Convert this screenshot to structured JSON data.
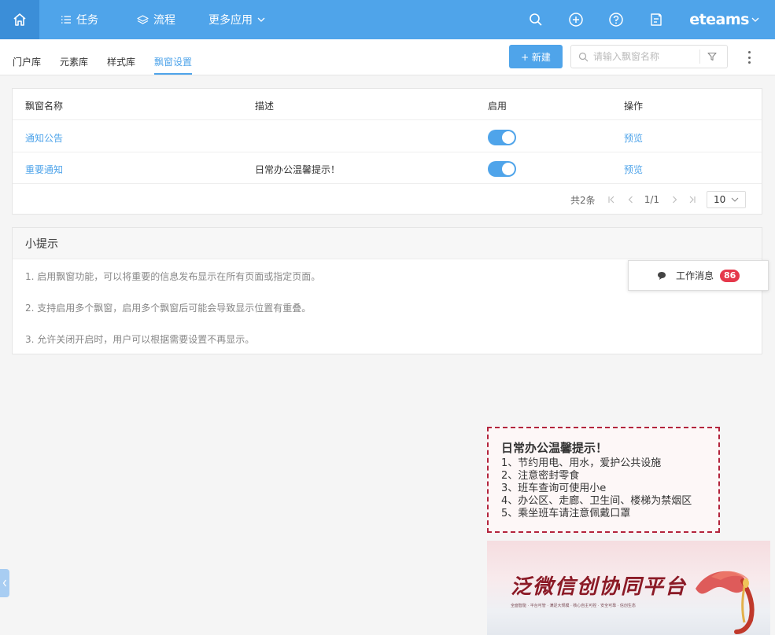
{
  "header": {
    "nav": [
      {
        "label": "任务"
      },
      {
        "label": "流程"
      },
      {
        "label": "更多应用"
      }
    ],
    "brand": "eteams"
  },
  "tabs": [
    {
      "label": "门户库",
      "active": false
    },
    {
      "label": "元素库",
      "active": false
    },
    {
      "label": "样式库",
      "active": false
    },
    {
      "label": "飘窗设置",
      "active": true
    }
  ],
  "toolbar": {
    "new_label": "+ 新建",
    "search_placeholder": "请输入飘窗名称"
  },
  "table": {
    "columns": [
      "飘窗名称",
      "描述",
      "启用",
      "操作"
    ],
    "rows": [
      {
        "name": "通知公告",
        "desc": "",
        "enabled": true,
        "action": "预览"
      },
      {
        "name": "重要通知",
        "desc": "日常办公温馨提示！",
        "enabled": true,
        "action": "预览"
      }
    ],
    "pagination": {
      "total": "共2条",
      "page": "1/1",
      "page_size": "10"
    }
  },
  "tips": {
    "title": "小提示",
    "items": [
      "1. 启用飘窗功能，可以将重要的信息发布显示在所有页面或指定页面。",
      "2. 支持启用多个飘窗，启用多个飘窗后可能会导致显示位置有重叠。",
      "3. 允许关闭开启时，用户可以根据需要设置不再显示。"
    ]
  },
  "work_message": {
    "label": "工作消息",
    "count": "86"
  },
  "notice": {
    "title": "日常办公温馨提示！",
    "lines": [
      "1、节约用电、用水，爱护公共设施",
      "2、注意密封零食",
      "3、班车查询可使用小e",
      "4、办公区、走廊、卫生间、楼梯为禁烟区",
      "5、乘坐班车请注意佩戴口罩"
    ]
  },
  "banner": {
    "title": "泛微信创协同平台",
    "subtitle": "全面智能 · 平台可管 · 满足大规模 · 核心自主可控 · 安全可靠 · 信创生态"
  },
  "colors": {
    "primary": "#4fa4ea",
    "home_bg": "#3b8ed8",
    "badge": "#e5384b",
    "notice_border": "#b3243c"
  },
  "icons": [
    "home-icon",
    "list-icon",
    "layers-icon",
    "chevron-down-icon",
    "search-icon",
    "plus-circle-icon",
    "help-icon",
    "note-icon",
    "filter-icon",
    "more-icon",
    "chat-bubble-icon",
    "chevron-left-icon"
  ]
}
